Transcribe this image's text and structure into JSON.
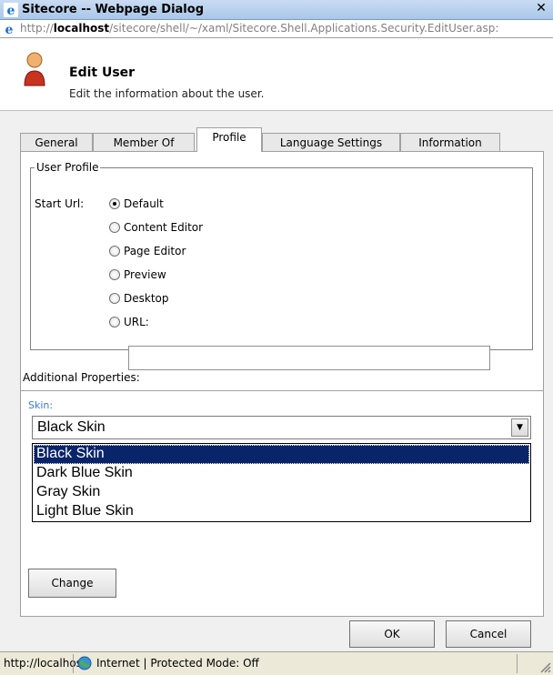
{
  "window": {
    "title": "Sitecore -- Webpage Dialog",
    "close_glyph": "✕",
    "url_prefix": "http://",
    "url_host": "localhost",
    "url_path": "/sitecore/shell/~/xaml/Sitecore.Shell.Applications.Security.EditUser.asp:"
  },
  "header": {
    "title": "Edit User",
    "subtitle": "Edit the information about the user.",
    "icon": "user-icon"
  },
  "tabs": [
    {
      "label": "General",
      "active": false
    },
    {
      "label": "Member Of",
      "active": false
    },
    {
      "label": "Profile",
      "active": true
    },
    {
      "label": "Language Settings",
      "active": false
    },
    {
      "label": "Information",
      "active": false
    }
  ],
  "user_profile": {
    "legend": "User Profile",
    "start_url_label": "Start Url:",
    "options": [
      {
        "label": "Default",
        "checked": true
      },
      {
        "label": "Content Editor",
        "checked": false
      },
      {
        "label": "Page Editor",
        "checked": false
      },
      {
        "label": "Preview",
        "checked": false
      },
      {
        "label": "Desktop",
        "checked": false
      },
      {
        "label": "URL:",
        "checked": false
      }
    ],
    "url_value": ""
  },
  "additional": {
    "heading": "Additional Properties:",
    "skin_label": "Skin:",
    "skin_value": "Black Skin",
    "skin_options": [
      "Black Skin",
      "Dark Blue Skin",
      "Gray Skin",
      "Light Blue Skin"
    ],
    "selected_index": 0,
    "change_button": "Change"
  },
  "footer": {
    "ok": "OK",
    "cancel": "Cancel"
  },
  "status": {
    "url": "http://localhos",
    "zone": "Internet | Protected Mode: Off"
  },
  "colors": {
    "selection": "#0a246a",
    "skin_label": "#3a7bd5",
    "titlebar": "#a9c6ea"
  }
}
